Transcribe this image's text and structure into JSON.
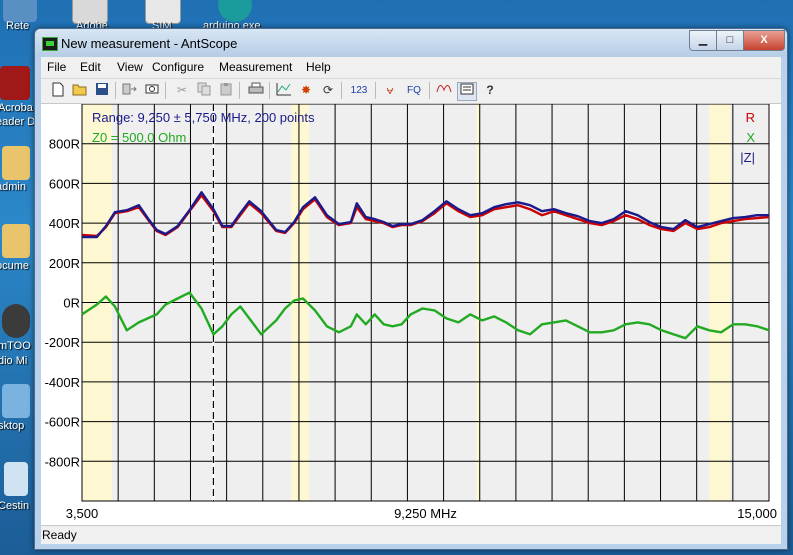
{
  "desktop": {
    "labels": [
      "Rete",
      "Adobe",
      "SIM",
      "arduino.exe",
      "Acroba",
      "eader D",
      "admin",
      "ocume",
      "mTOO",
      "dio Mi",
      "sktop",
      "Cestin"
    ]
  },
  "window": {
    "title": "New measurement - AntScope",
    "min_label": "▁",
    "max_label": "□",
    "close_label": "X"
  },
  "menu": [
    "File",
    "Edit",
    "View",
    "Configure",
    "Measurement",
    "Help"
  ],
  "toolbar": {
    "icons": [
      "new-icon",
      "open-icon",
      "save-icon",
      "export-icon",
      "camera-icon",
      "cut-icon",
      "copy-icon",
      "paste-icon",
      "print-icon",
      "chart-icon",
      "burst-icon",
      "refresh-icon",
      "numbers-icon",
      "antenna-icon",
      "fq-icon",
      "curve-icon",
      "settings-icon",
      "help-icon"
    ],
    "numbers_label": "123",
    "fq_label": "FQ",
    "help_label": "?"
  },
  "status": {
    "text": "Ready"
  },
  "chart_data": {
    "type": "line",
    "title": "Range: 9,250 ± 5,750 MHz, 200 points",
    "subtitle": "Z0 = 500,0 Ohm",
    "xlim": [
      3.5,
      15.0
    ],
    "ylim": [
      -1000,
      1000
    ],
    "x_tick_labels": [
      "3,500",
      "9,250 MHz",
      "15,000"
    ],
    "y_ticks": [
      800,
      600,
      400,
      200,
      0,
      -200,
      -400,
      -600,
      -800
    ],
    "y_tick_labels": [
      "800R",
      "600R",
      "400R",
      "200R",
      "0R",
      "-200R",
      "-400R",
      "-600R",
      "-800R"
    ],
    "grid": true,
    "legend_position": "top-right",
    "bands": [
      [
        3.5,
        4.0
      ],
      [
        7.0,
        7.3
      ],
      [
        10.1,
        10.15
      ],
      [
        14.0,
        14.35
      ]
    ],
    "cursor_x": 5.7,
    "x": [
      3.5,
      3.75,
      3.9,
      4.05,
      4.25,
      4.45,
      4.6,
      4.75,
      4.9,
      5.1,
      5.3,
      5.5,
      5.7,
      5.85,
      6.0,
      6.15,
      6.3,
      6.5,
      6.75,
      6.9,
      7.05,
      7.2,
      7.4,
      7.6,
      7.8,
      8.0,
      8.1,
      8.25,
      8.4,
      8.55,
      8.7,
      8.85,
      9.0,
      9.2,
      9.4,
      9.6,
      9.8,
      10.0,
      10.2,
      10.4,
      10.6,
      10.8,
      11.0,
      11.2,
      11.4,
      11.6,
      11.8,
      12.0,
      12.2,
      12.4,
      12.6,
      12.8,
      13.0,
      13.2,
      13.4,
      13.6,
      13.8,
      14.0,
      14.2,
      14.4,
      14.6,
      14.8,
      15.0
    ],
    "series": [
      {
        "name": "R",
        "color": "#cc0000",
        "values": [
          340,
          335,
          380,
          450,
          460,
          480,
          420,
          360,
          340,
          380,
          460,
          540,
          460,
          380,
          380,
          440,
          500,
          450,
          360,
          350,
          400,
          470,
          520,
          430,
          390,
          400,
          480,
          420,
          410,
          400,
          380,
          390,
          390,
          410,
          450,
          500,
          460,
          430,
          440,
          470,
          480,
          490,
          470,
          440,
          460,
          440,
          420,
          400,
          390,
          410,
          440,
          420,
          390,
          370,
          360,
          400,
          370,
          380,
          400,
          410,
          420,
          425,
          430
        ]
      },
      {
        "name": "|Z|",
        "color": "#1a1a8c",
        "values": [
          330,
          330,
          385,
          455,
          465,
          490,
          425,
          365,
          345,
          385,
          465,
          555,
          470,
          385,
          385,
          450,
          510,
          460,
          365,
          355,
          405,
          480,
          530,
          440,
          395,
          405,
          500,
          430,
          420,
          405,
          385,
          395,
          395,
          415,
          460,
          510,
          470,
          440,
          450,
          480,
          495,
          505,
          490,
          460,
          470,
          450,
          435,
          410,
          400,
          420,
          460,
          440,
          405,
          380,
          370,
          415,
          380,
          395,
          410,
          425,
          430,
          440,
          440
        ]
      },
      {
        "name": "X",
        "color": "#22aa22",
        "values": [
          -60,
          -10,
          30,
          -20,
          -140,
          -100,
          -80,
          -60,
          -10,
          20,
          50,
          -30,
          -160,
          -120,
          -60,
          -20,
          -80,
          -160,
          -90,
          -30,
          10,
          20,
          -40,
          -120,
          -150,
          -120,
          -60,
          -110,
          -60,
          -110,
          -120,
          -110,
          -60,
          -30,
          -40,
          -80,
          -100,
          -60,
          -90,
          -70,
          -100,
          -140,
          -160,
          -110,
          -100,
          -90,
          -120,
          -150,
          -150,
          -140,
          -110,
          -100,
          -110,
          -140,
          -160,
          -180,
          -120,
          -140,
          -150,
          -110,
          -110,
          -120,
          -140
        ]
      }
    ]
  }
}
